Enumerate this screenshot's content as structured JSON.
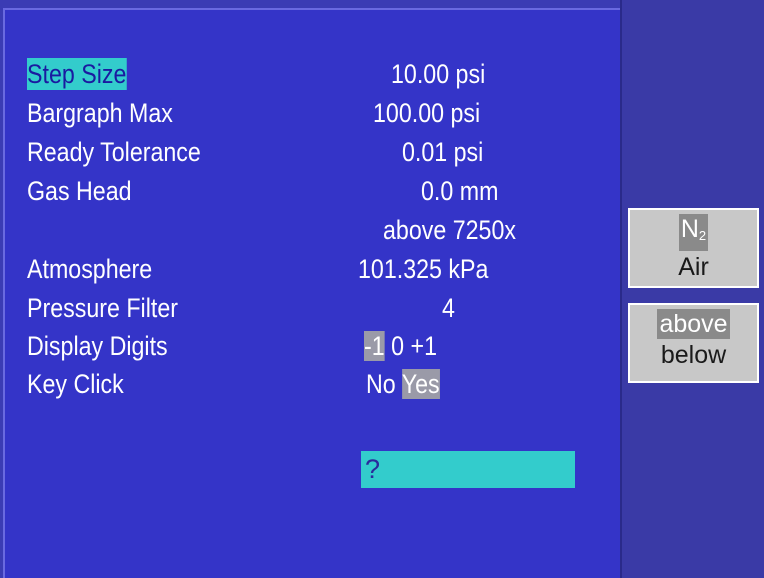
{
  "menu": {
    "items": [
      {
        "label": "Step Size",
        "value": "10.00 psi"
      },
      {
        "label": "Bargraph Max",
        "value": "100.00 psi"
      },
      {
        "label": "Ready Tolerance",
        "value": "0.01 psi"
      },
      {
        "label": "Gas Head",
        "value": "0.0 mm"
      },
      {
        "label": "",
        "value": "above 7250x"
      },
      {
        "label": "Atmosphere",
        "value": "101.325 kPa"
      },
      {
        "label": "Pressure Filter",
        "value": "4"
      },
      {
        "label": "Display Digits",
        "options": [
          "-1",
          "0",
          "+1"
        ],
        "selected": "-1"
      },
      {
        "label": "Key Click",
        "options": [
          "No",
          "Yes"
        ],
        "selected": "Yes"
      }
    ],
    "selected_item": "Step Size"
  },
  "input": {
    "value": "?"
  },
  "softkeys": [
    {
      "options": [
        "N",
        "Air"
      ],
      "subscript": "2",
      "selected": "N2"
    },
    {
      "options": [
        "above",
        "below"
      ],
      "selected": "above"
    }
  ],
  "colors": {
    "background": "#3434c8",
    "highlight": "#33cccc",
    "option_highlight": "#9a9aa8",
    "softkey_bg": "#c8c8c8"
  }
}
